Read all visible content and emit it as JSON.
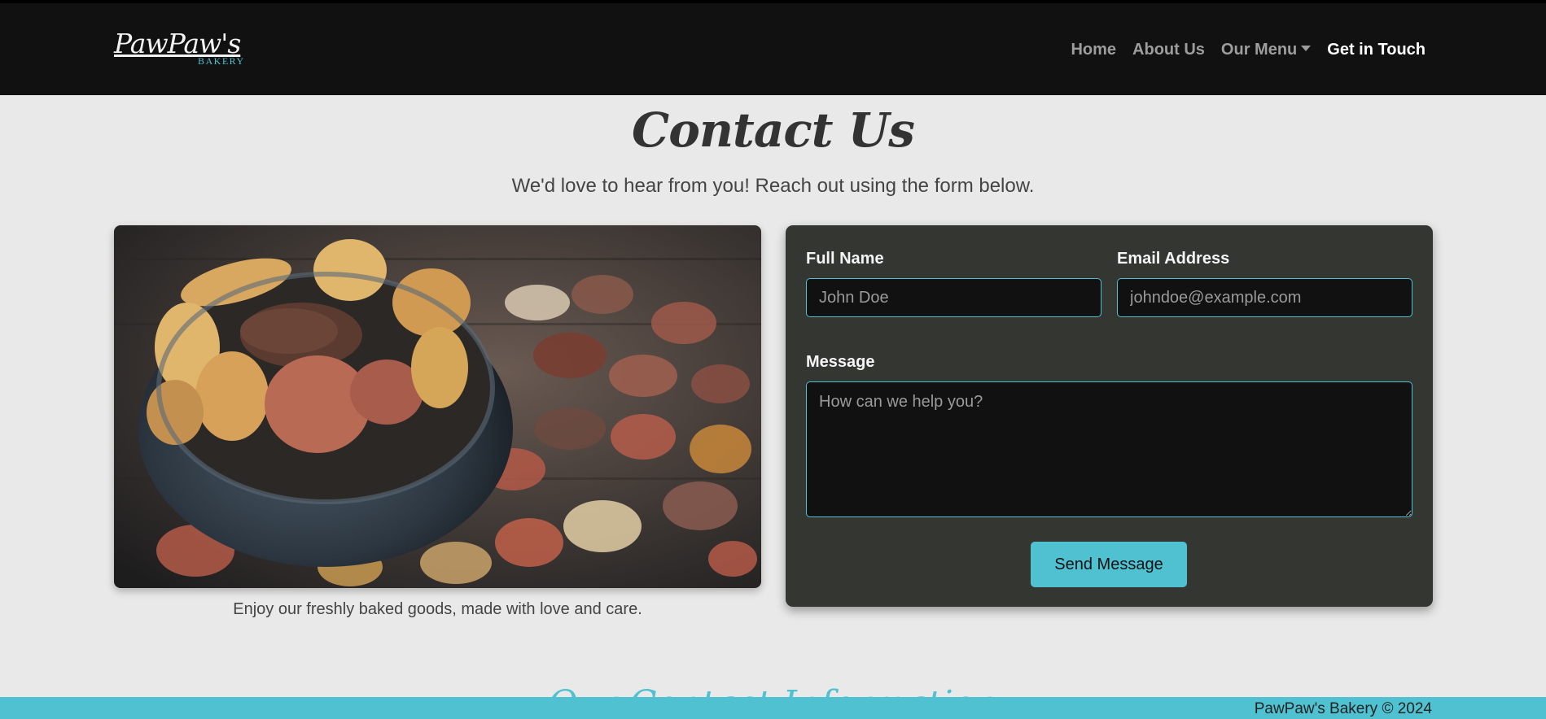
{
  "brand": {
    "logo_script": "PawPaw's",
    "logo_sub": "BAKERY"
  },
  "nav": {
    "items": [
      {
        "label": "Home"
      },
      {
        "label": "About Us"
      },
      {
        "label": "Our Menu"
      },
      {
        "label": "Get in Touch"
      }
    ]
  },
  "page": {
    "title": "Contact Us",
    "subtitle": "We'd love to hear from you! Reach out using the form below."
  },
  "image": {
    "caption": "Enjoy our freshly baked goods, made with love and care."
  },
  "form": {
    "name_label": "Full Name",
    "name_placeholder": "John Doe",
    "email_label": "Email Address",
    "email_placeholder": "johndoe@example.com",
    "message_label": "Message",
    "message_placeholder": "How can we help you?",
    "submit_label": "Send Message"
  },
  "next_section": {
    "title": "Our Contact Information"
  },
  "footer": {
    "copyright": "PawPaw's Bakery © 2024"
  },
  "colors": {
    "accent": "#4fc1d1",
    "topbar": "#111111",
    "form_bg": "#343632",
    "page_bg": "#e9e9e9"
  }
}
